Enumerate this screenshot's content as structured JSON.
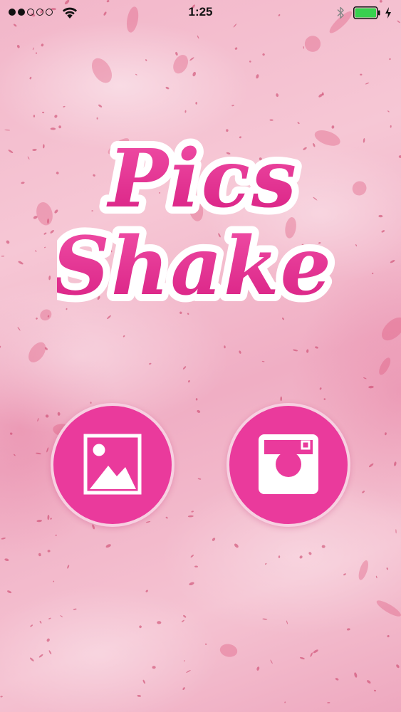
{
  "status_bar": {
    "time": "1:25",
    "signal_filled": 2,
    "signal_total": 5,
    "battery_level": 1.0,
    "battery_color": "#38d14f",
    "icons": [
      "wifi-icon",
      "bluetooth-icon",
      "battery-icon",
      "charging-icon"
    ]
  },
  "logo": {
    "line1": "Pics",
    "line2": "Shake",
    "fill_color": "#e02a8d",
    "outline_color": "#ffffff"
  },
  "buttons": {
    "gallery": {
      "icon": "gallery-icon"
    },
    "camera": {
      "icon": "instagram-camera-icon"
    }
  },
  "colors": {
    "accent": "#ea3a9c",
    "background": "#f4bccd"
  }
}
